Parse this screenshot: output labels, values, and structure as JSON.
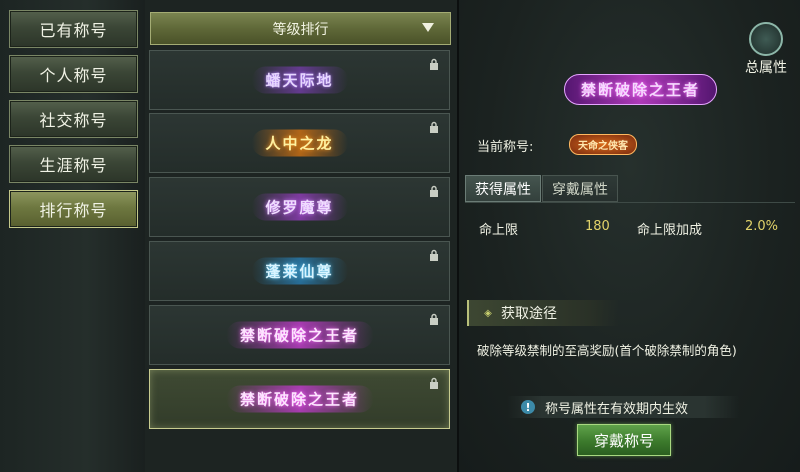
{
  "categories": [
    {
      "label": "已有称号"
    },
    {
      "label": "个人称号"
    },
    {
      "label": "社交称号"
    },
    {
      "label": "生涯称号"
    },
    {
      "label": "排行称号"
    }
  ],
  "active_category": "排行称号",
  "filter_dropdown": {
    "selected": "等级排行"
  },
  "titles": [
    {
      "text": "蟠天际地",
      "locked": true,
      "style": "purple-dark"
    },
    {
      "text": "人中之龙",
      "locked": true,
      "style": "gold-fire"
    },
    {
      "text": "修罗魔尊",
      "locked": true,
      "style": "violet"
    },
    {
      "text": "蓬莱仙尊",
      "locked": true,
      "style": "cyan"
    },
    {
      "text": "禁断破除之王者",
      "locked": true,
      "style": "magenta"
    },
    {
      "text": "禁断破除之王者",
      "locked": true,
      "style": "magenta",
      "selected": true
    }
  ],
  "detail": {
    "total_attr_label": "总属性",
    "preview_title": "禁断破除之王者",
    "current_title_label": "当前称号:",
    "current_title": "天命之侠客",
    "tabs": {
      "obtained": "获得属性",
      "wear": "穿戴属性"
    },
    "attributes": {
      "name1": "命上限",
      "value1": "180",
      "name2": "命上限加成",
      "value2": "2.0%"
    },
    "acquire_label": "获取途径",
    "acquire_desc": "破除等级禁制的至高奖励(首个破除禁制的角色)",
    "notice": "称号属性在有效期内生效",
    "wear_button": "穿戴称号"
  },
  "colors": {
    "active_category": "#6e7840",
    "attr_value": "#e2d36a",
    "wear_button": "#3c7a2c"
  }
}
